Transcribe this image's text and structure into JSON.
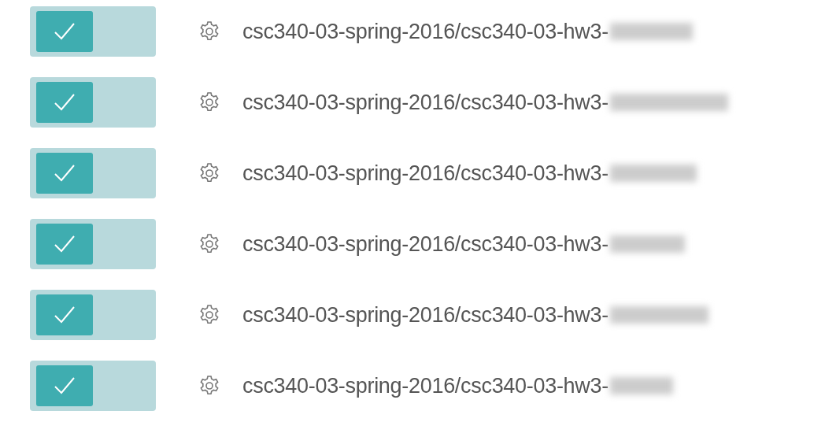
{
  "repos": [
    {
      "name": "csc340-03-spring-2016/csc340-03-hw3-",
      "on": true
    },
    {
      "name": "csc340-03-spring-2016/csc340-03-hw3-",
      "on": true
    },
    {
      "name": "csc340-03-spring-2016/csc340-03-hw3-",
      "on": true
    },
    {
      "name": "csc340-03-spring-2016/csc340-03-hw3-",
      "on": true
    },
    {
      "name": "csc340-03-spring-2016/csc340-03-hw3-",
      "on": true
    },
    {
      "name": "csc340-03-spring-2016/csc340-03-hw3-",
      "on": true
    }
  ]
}
